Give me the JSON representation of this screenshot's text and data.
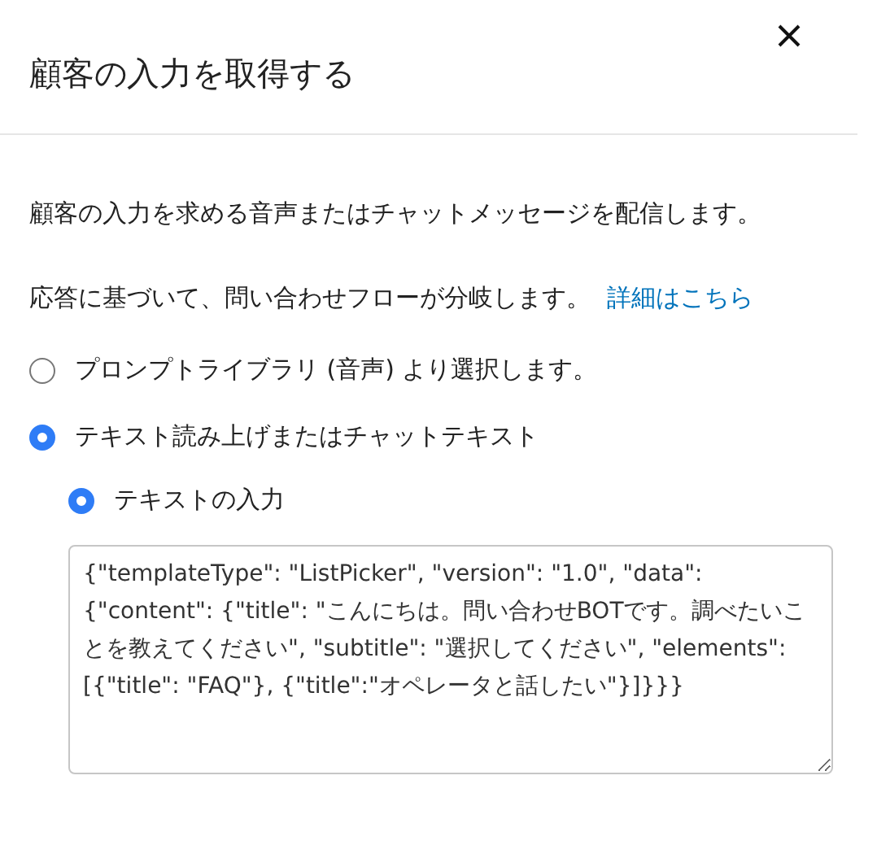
{
  "dialog": {
    "title": "顧客の入力を取得する"
  },
  "description": "顧客の入力を求める音声またはチャットメッセージを配信します。",
  "branch_note": {
    "text": "応答に基づいて、問い合わせフローが分岐します。",
    "link": "詳細はこちら"
  },
  "options": [
    {
      "label": "プロンプトライブラリ (音声) より選択します。",
      "selected": false
    },
    {
      "label": "テキスト読み上げまたはチャットテキスト",
      "selected": true,
      "children": [
        {
          "label": "テキストの入力",
          "selected": true
        }
      ]
    }
  ],
  "text_input": {
    "value": "{\"templateType\": \"ListPicker\", \"version\": \"1.0\", \"data\": {\"content\": {\"title\": \"こんにちは。問い合わせBOTです。調べたいことを教えてください\", \"subtitle\": \"選択してください\", \"elements\": [{\"title\": \"FAQ\"}, {\"title\":\"オペレータと話したい\"}]}}}"
  }
}
